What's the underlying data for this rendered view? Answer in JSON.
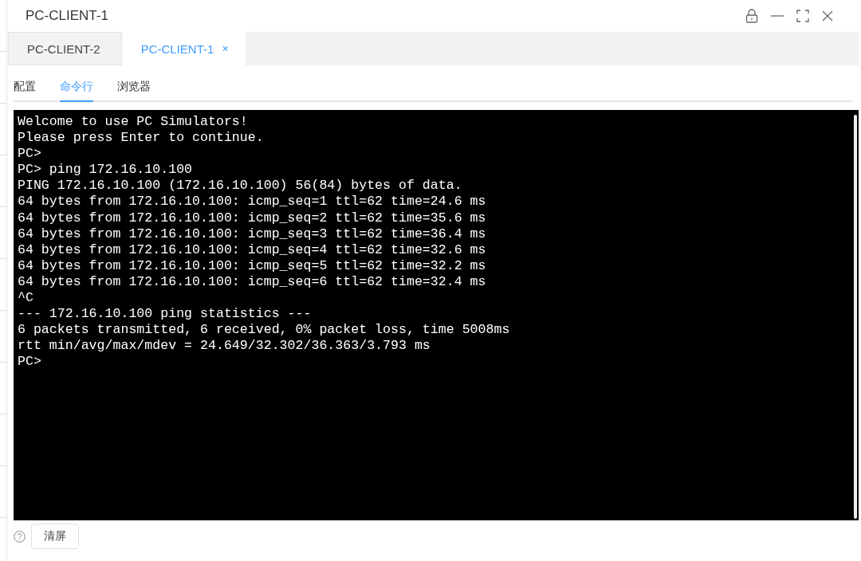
{
  "window": {
    "title": "PC-CLIENT-1"
  },
  "tabs": [
    {
      "label": "PC-CLIENT-2",
      "selected": false
    },
    {
      "label": "PC-CLIENT-1",
      "selected": true,
      "close_label": "×"
    }
  ],
  "subtabs": [
    {
      "label": "配置",
      "selected": false
    },
    {
      "label": "命令行",
      "selected": true
    },
    {
      "label": "浏览器",
      "selected": false
    }
  ],
  "terminal": {
    "lines": [
      "Welcome to use PC Simulators!",
      "Please press Enter to continue.",
      "PC>",
      "PC> ping 172.16.10.100",
      "PING 172.16.10.100 (172.16.10.100) 56(84) bytes of data.",
      "64 bytes from 172.16.10.100: icmp_seq=1 ttl=62 time=24.6 ms",
      "64 bytes from 172.16.10.100: icmp_seq=2 ttl=62 time=35.6 ms",
      "64 bytes from 172.16.10.100: icmp_seq=3 ttl=62 time=36.4 ms",
      "64 bytes from 172.16.10.100: icmp_seq=4 ttl=62 time=32.6 ms",
      "64 bytes from 172.16.10.100: icmp_seq=5 ttl=62 time=32.2 ms",
      "64 bytes from 172.16.10.100: icmp_seq=6 ttl=62 time=32.4 ms",
      "^C",
      "--- 172.16.10.100 ping statistics ---",
      "6 packets transmitted, 6 received, 0% packet loss, time 5008ms",
      "rtt min/avg/max/mdev = 24.649/32.302/36.363/3.793 ms",
      "PC>"
    ]
  },
  "footer": {
    "clear_button": "清屏"
  }
}
